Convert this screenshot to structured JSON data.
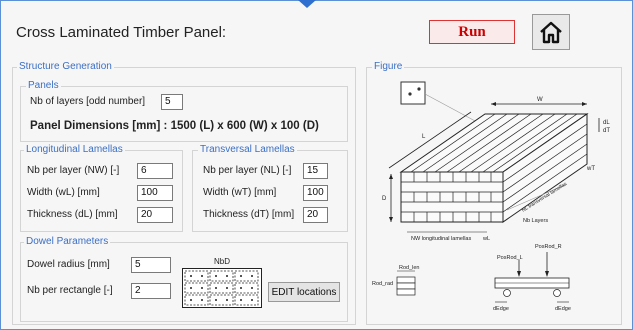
{
  "app": {
    "title": "Cross Laminated Timber Panel:",
    "run_label": "Run"
  },
  "structure": {
    "legend": "Structure Generation",
    "panels": {
      "legend": "Panels",
      "layers_label": "Nb of layers [odd number]",
      "layers_value": "5",
      "dimensions": "Panel Dimensions [mm] : 1500 (L) x 600 (W) x 100 (D)"
    },
    "longitudinal": {
      "legend": "Longitudinal Lamellas",
      "nb_label": "Nb per layer (NW) [-]",
      "nb_value": "6",
      "width_label": "Width (wL) [mm]",
      "width_value": "100",
      "thick_label": "Thickness (dL) [mm]",
      "thick_value": "20"
    },
    "transversal": {
      "legend": "Transversal Lamellas",
      "nb_label": "Nb per layer (NL) [-]",
      "nb_value": "15",
      "width_label": "Width (wT) [mm]",
      "width_value": "100",
      "thick_label": "Thickness (dT) [mm]",
      "thick_value": "20"
    },
    "dowel": {
      "legend": "Dowel Parameters",
      "radius_label": "Dowel radius [mm]",
      "radius_value": "5",
      "nb_label": "Nb per rectangle [-]",
      "nb_value": "2",
      "nbd_label": "NbD",
      "edit_label": "EDIT locations"
    }
  },
  "figure": {
    "legend": "Figure",
    "labels": {
      "w": "W",
      "l": "L",
      "d": "D",
      "dl": "dL",
      "dt": "dT",
      "nb_transversal": "NL transversal lamellas",
      "nb_layers": "Nb Layers",
      "nw_long": "NW longitudinal lamellas",
      "wl": "wL",
      "wt": "wT",
      "rod_len": "Rod_len",
      "rod_rad": "Rod_rad",
      "posrod_r": "PosRod_R",
      "posrod_l": "PosRod_L",
      "edge_l": "dEdge",
      "edge_r": "dEdge"
    }
  }
}
